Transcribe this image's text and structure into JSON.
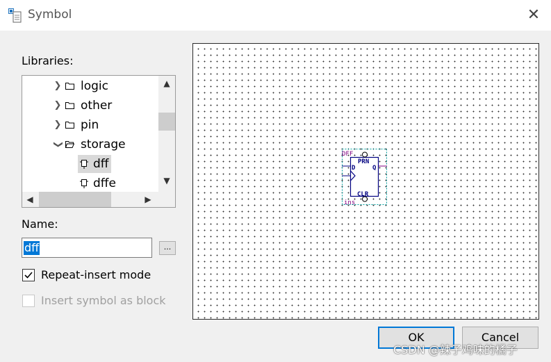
{
  "window": {
    "title": "Symbol",
    "close_glyph": "✕"
  },
  "libraries": {
    "label": "Libraries:",
    "items": [
      {
        "label": "logic",
        "expanded": false,
        "type": "folder"
      },
      {
        "label": "other",
        "expanded": false,
        "type": "folder"
      },
      {
        "label": "pin",
        "expanded": false,
        "type": "folder"
      },
      {
        "label": "storage",
        "expanded": true,
        "type": "folder"
      },
      {
        "label": "dff",
        "type": "symbol",
        "selected": true
      },
      {
        "label": "dffe",
        "type": "symbol"
      }
    ]
  },
  "name": {
    "label": "Name:",
    "value": "dff",
    "browse_label": "..."
  },
  "options": {
    "repeat_insert": {
      "label": "Repeat-insert mode",
      "checked": true
    },
    "insert_as_block": {
      "label": "Insert symbol as block",
      "checked": false,
      "disabled": true
    }
  },
  "preview": {
    "symbol_name": "DFF",
    "instance": "ins",
    "pins": {
      "prn": "PRN",
      "clrn": "CLR",
      "d": "D",
      "q": "Q"
    },
    "colors": {
      "pin": "#800080",
      "body": "#000080",
      "bbox": "#00a0a0"
    }
  },
  "buttons": {
    "ok": "OK",
    "cancel": "Cancel"
  },
  "watermark": "CSDN @辣子鸡味的橘子",
  "colors": {
    "accent": "#0078d7",
    "window_bg": "#f0f0f0"
  }
}
